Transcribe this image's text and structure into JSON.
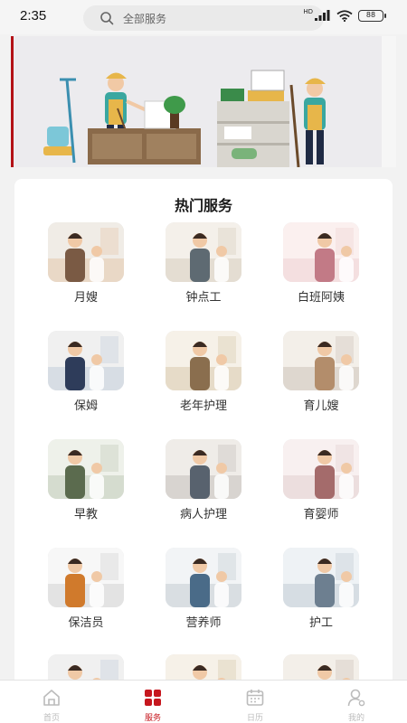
{
  "status_bar": {
    "time": "2:35",
    "network": "HD",
    "battery": "88"
  },
  "search": {
    "placeholder": "全部服务"
  },
  "section": {
    "title": "热门服务"
  },
  "services": [
    {
      "label": "月嫂",
      "name": "service-yuesao"
    },
    {
      "label": "钟点工",
      "name": "service-hourly-worker"
    },
    {
      "label": "白班阿姨",
      "name": "service-day-nanny"
    },
    {
      "label": "保姆",
      "name": "service-nanny"
    },
    {
      "label": "老年护理",
      "name": "service-elderly-care"
    },
    {
      "label": "育儿嫂",
      "name": "service-childcare"
    },
    {
      "label": "早教",
      "name": "service-early-education"
    },
    {
      "label": "病人护理",
      "name": "service-patient-care"
    },
    {
      "label": "育婴师",
      "name": "service-infant-care"
    },
    {
      "label": "保洁员",
      "name": "service-cleaner"
    },
    {
      "label": "营养师",
      "name": "service-nutritionist"
    },
    {
      "label": "护工",
      "name": "service-caregiver"
    }
  ],
  "tabs": [
    {
      "label": "首页",
      "icon": "home-icon",
      "active": false
    },
    {
      "label": "服务",
      "icon": "services-grid-icon",
      "active": true
    },
    {
      "label": "日历",
      "icon": "calendar-icon",
      "active": false
    },
    {
      "label": "我的",
      "icon": "profile-icon",
      "active": false
    }
  ],
  "colors": {
    "accent": "#c6171e",
    "tab_inactive": "#bbbbbb",
    "banner_bg": "#ecebee"
  }
}
